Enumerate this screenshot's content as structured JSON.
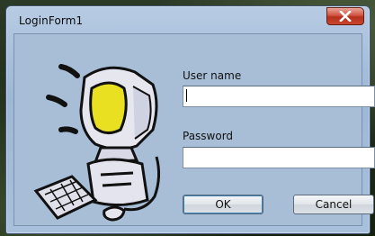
{
  "window": {
    "title": "LoginForm1",
    "close_glyph": "x"
  },
  "form": {
    "username_label": "User name",
    "username_value": "",
    "password_label": "Password",
    "password_value": ""
  },
  "buttons": {
    "ok_label": "OK",
    "cancel_label": "Cancel"
  },
  "illustration": {
    "icon": "computer-user-icon"
  },
  "colors": {
    "title_close": "#c9482d",
    "client_bg": "#a8bed6",
    "monitor_screen": "#e8e020"
  }
}
